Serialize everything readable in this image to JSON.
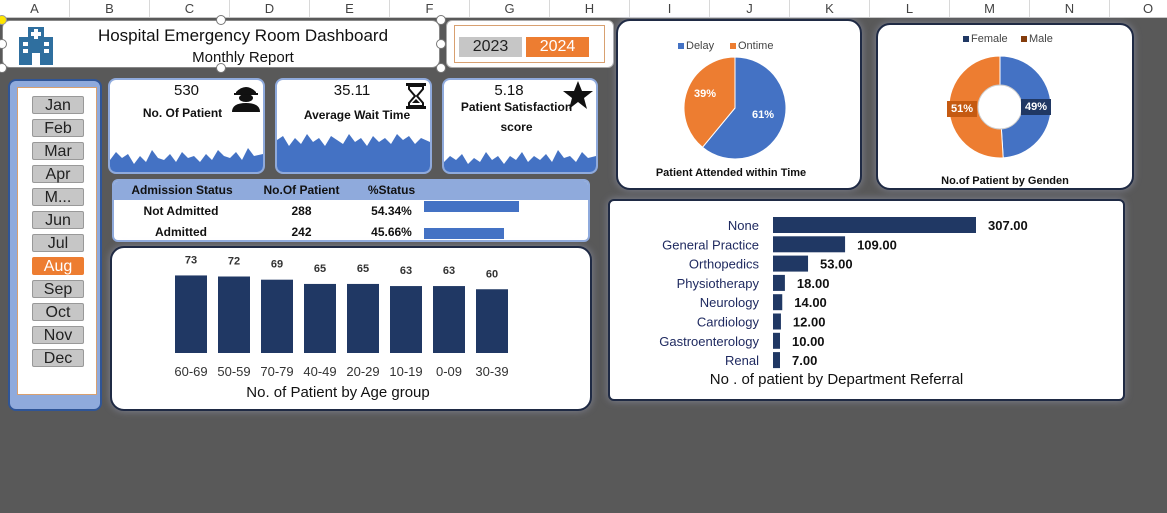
{
  "sheet": {
    "columns": [
      "A",
      "B",
      "C",
      "D",
      "E",
      "F",
      "G",
      "H",
      "I",
      "J",
      "K",
      "L",
      "M",
      "N",
      "O"
    ]
  },
  "header": {
    "title": "Hospital Emergency Room Dashboard",
    "subtitle": "Monthly Report",
    "icon": "hospital-icon"
  },
  "years": {
    "items": [
      "2023",
      "2024"
    ],
    "selected": "2024"
  },
  "months": {
    "items": [
      "Jan",
      "Feb",
      "Mar",
      "Apr",
      "M...",
      "Jun",
      "Jul",
      "Aug",
      "Sep",
      "Oct",
      "Nov",
      "Dec"
    ],
    "selected": "Aug"
  },
  "kpis": {
    "patients": {
      "value": "530",
      "label": "No. Of Patient",
      "icon": "patient-icon"
    },
    "wait": {
      "value": "35.11",
      "label": "Average Wait Time",
      "icon": "hourglass-icon"
    },
    "satisfaction": {
      "value": "5.18",
      "label1": "Patient Satisfaction",
      "label2": "score",
      "icon": "star-icon"
    }
  },
  "admission": {
    "headers": [
      "Admission Status",
      "No.Of Patient",
      "%Status"
    ],
    "rows": [
      {
        "status": "Not Admitted",
        "count": "288",
        "pct": "54.34%",
        "fraction": 0.5434
      },
      {
        "status": "Admitted",
        "count": "242",
        "pct": "45.66%",
        "fraction": 0.4566
      }
    ]
  },
  "colors": {
    "navy": "#203864",
    "blue": "#4472c4",
    "orange": "#ed7d31",
    "light_blue": "#8faadc"
  },
  "chart_data": [
    {
      "type": "bar",
      "title": "No. of Patient by Age group",
      "categories": [
        "60-69",
        "50-59",
        "70-79",
        "40-49",
        "20-29",
        "10-19",
        "0-09",
        "30-39"
      ],
      "values": [
        73,
        72,
        69,
        65,
        65,
        63,
        63,
        60
      ],
      "ylim": [
        0,
        80
      ]
    },
    {
      "type": "pie",
      "title": "Patient Attended within Time",
      "legend": [
        "Delay",
        "Ontime"
      ],
      "labels": [
        "Delay",
        "Ontime"
      ],
      "values": [
        61,
        39
      ],
      "value_labels": [
        "61%",
        "39%"
      ],
      "colors": [
        "#4472c4",
        "#ed7d31"
      ],
      "legend_position": "top"
    },
    {
      "type": "pie",
      "title": "No.of Patient by Genden",
      "legend": [
        "Female",
        "Male"
      ],
      "labels": [
        "Female",
        "Male"
      ],
      "values": [
        49,
        51
      ],
      "value_labels": [
        "49%",
        "51%"
      ],
      "colors": [
        "#4472c4",
        "#ed7d31"
      ],
      "legend_colors": [
        "#203864",
        "#843c0c"
      ],
      "legend_position": "top"
    },
    {
      "type": "bar",
      "orientation": "horizontal",
      "title": "No . of patient by Department Referral",
      "categories": [
        "None",
        "General Practice",
        "Orthopedics",
        "Physiotherapy",
        "Neurology",
        "Cardiology",
        "Gastroenterology",
        "Renal"
      ],
      "values": [
        307,
        109,
        53,
        18,
        14,
        12,
        10,
        7
      ],
      "value_labels": [
        "307.00",
        "109.00",
        "53.00",
        "18.00",
        "14.00",
        "12.00",
        "10.00",
        "7.00"
      ],
      "xlim": [
        0,
        307
      ]
    }
  ]
}
